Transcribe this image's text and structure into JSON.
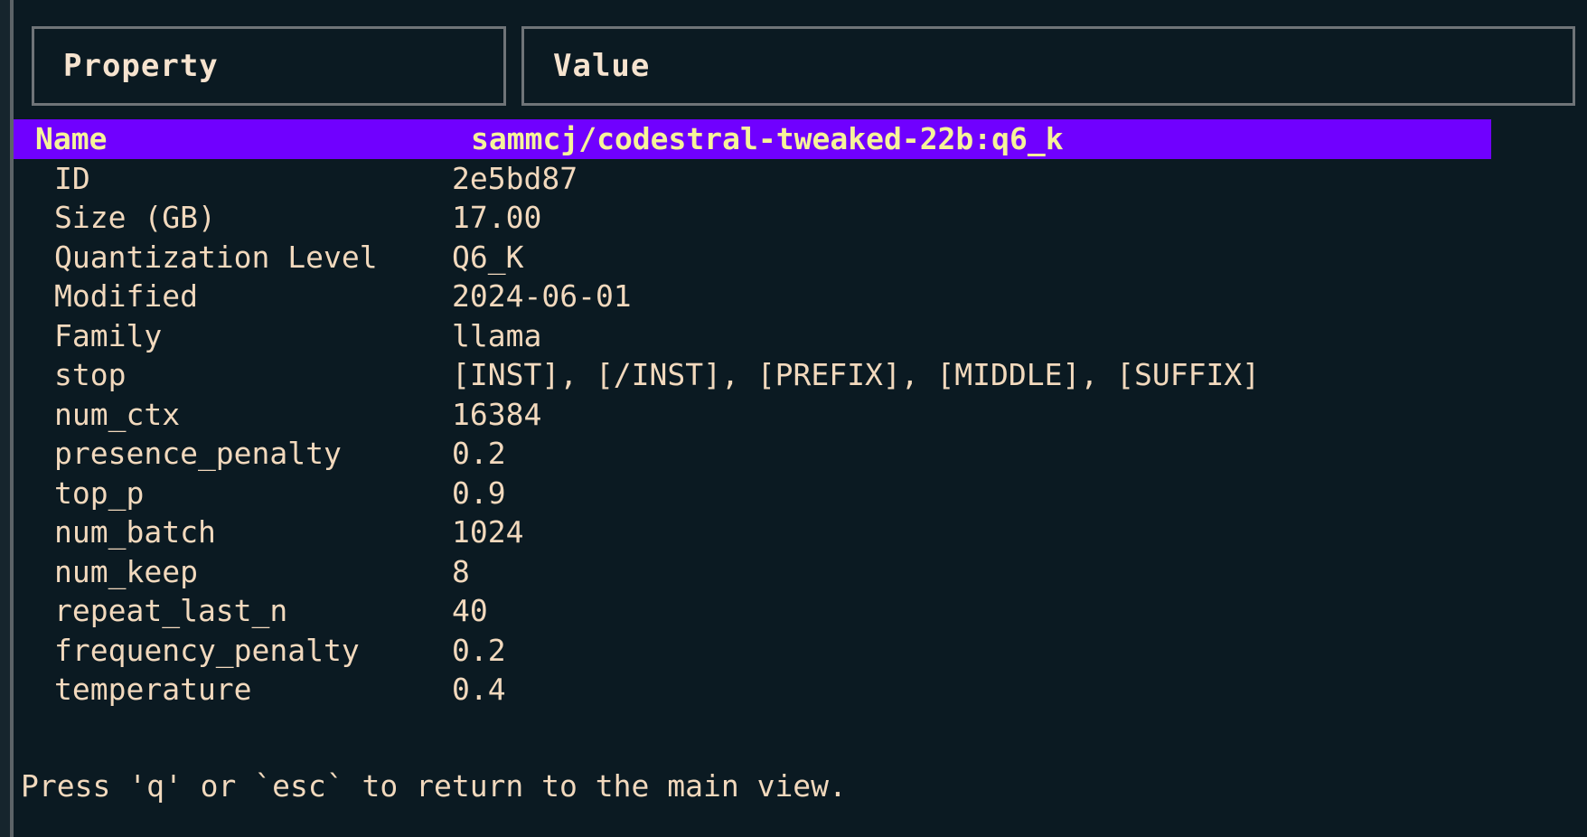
{
  "table": {
    "columns": [
      {
        "key": "property",
        "label": "Property"
      },
      {
        "key": "value",
        "label": "Value"
      }
    ],
    "selected_index": 0,
    "rows": [
      {
        "property": "Name",
        "value": "sammcj/codestral-tweaked-22b:q6_k",
        "selected": true
      },
      {
        "property": "ID",
        "value": "2e5bd87",
        "selected": false
      },
      {
        "property": "Size (GB)",
        "value": "17.00",
        "selected": false
      },
      {
        "property": "Quantization Level",
        "value": "Q6_K",
        "selected": false
      },
      {
        "property": "Modified",
        "value": "2024-06-01",
        "selected": false
      },
      {
        "property": "Family",
        "value": "llama",
        "selected": false
      },
      {
        "property": "stop",
        "value": "[INST], [/INST], [PREFIX], [MIDDLE], [SUFFIX]",
        "selected": false
      },
      {
        "property": "num_ctx",
        "value": "16384",
        "selected": false
      },
      {
        "property": "presence_penalty",
        "value": "0.2",
        "selected": false
      },
      {
        "property": "top_p",
        "value": "0.9",
        "selected": false
      },
      {
        "property": "num_batch",
        "value": "1024",
        "selected": false
      },
      {
        "property": "num_keep",
        "value": "8",
        "selected": false
      },
      {
        "property": "repeat_last_n",
        "value": "40",
        "selected": false
      },
      {
        "property": "frequency_penalty",
        "value": "0.2",
        "selected": false
      },
      {
        "property": "temperature",
        "value": "0.4",
        "selected": false
      }
    ]
  },
  "footer": {
    "hint": "Press 'q' or `esc` to return to the main view."
  },
  "colors": {
    "background": "#0b1a22",
    "gutter": "#16252d",
    "border": "#6f7478",
    "text": "#f2d9bd",
    "header_text": "#f6e3cf",
    "selection_background": "#7000ff",
    "selection_text": "#f6f39a"
  }
}
